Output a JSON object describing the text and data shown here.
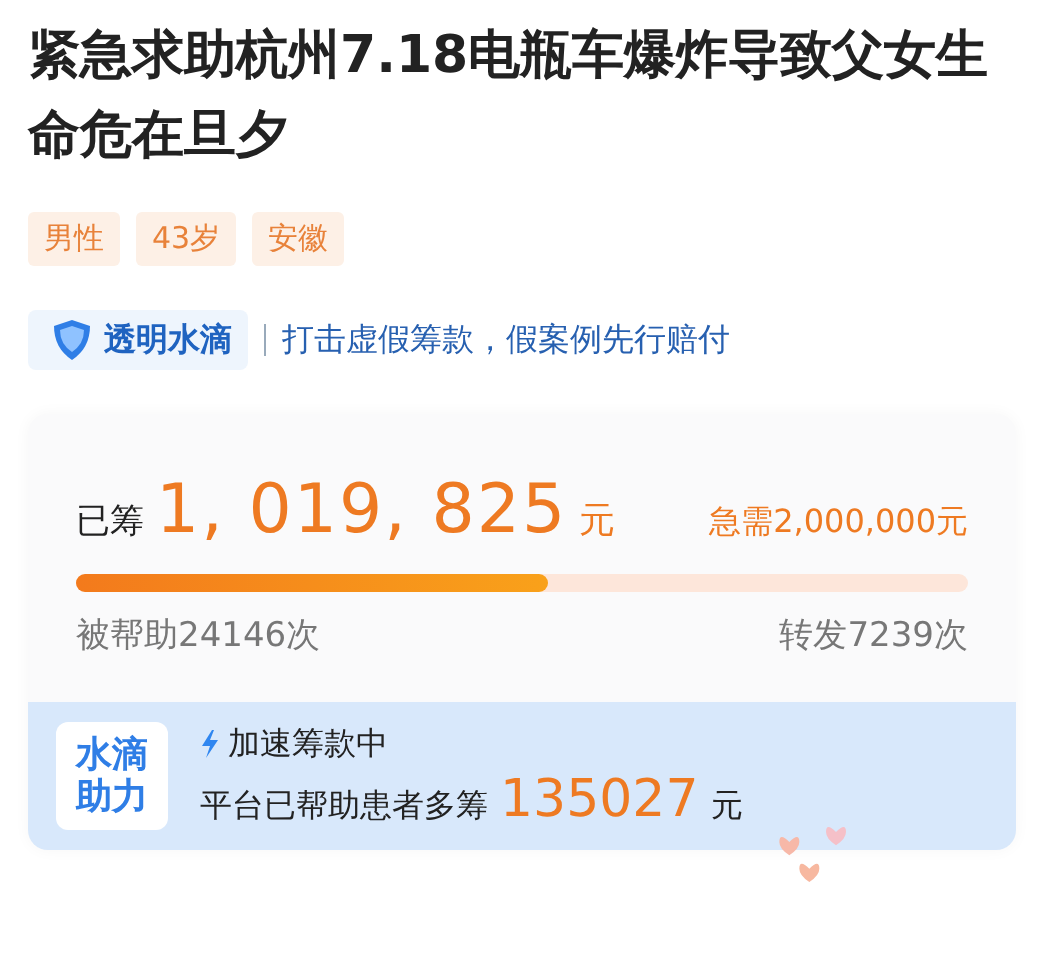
{
  "title": "紧急求助杭州7.18电瓶车爆炸导致父女生命危在旦夕",
  "tags": [
    "男性",
    "43岁",
    "安徽"
  ],
  "assurance": {
    "badge": "透明水滴",
    "slogan": "打击虚假筹款，假案例先行赔付"
  },
  "funding": {
    "raised_label": "已筹",
    "raised_amount": "1, 019, 825",
    "raised_unit": "元",
    "goal": "急需2,000,000元",
    "level": 0.53,
    "helped": "被帮助24146次",
    "shares": "转发7239次"
  },
  "boost": {
    "logo": "水滴助力",
    "status": "加速筹款中",
    "message": "平台已帮助患者多筹",
    "amount": "135027",
    "unit": "元"
  }
}
